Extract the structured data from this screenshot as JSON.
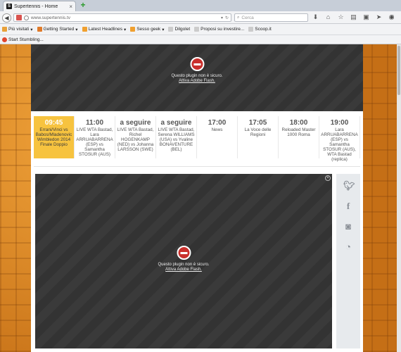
{
  "browser": {
    "tab_title": "Supertennis - Home",
    "tab_favicon": "S",
    "url": "www.supertennis.tv",
    "search_placeholder": "Cerca"
  },
  "bookmarks": [
    {
      "label": "Più visitati",
      "color": "#e8a13a"
    },
    {
      "label": "Getting Started",
      "color": "#e07b2a"
    },
    {
      "label": "Latest Headlines",
      "color": "#f0a030"
    },
    {
      "label": "Sesso geek",
      "color": "#f0a030"
    },
    {
      "label": "Dilgolet",
      "color": "#cccccc"
    },
    {
      "label": "Proposi su investire...",
      "color": "#cccccc"
    },
    {
      "label": "Scoop.it",
      "color": "#cccccc"
    }
  ],
  "bookmarks2": {
    "label": "Start Stumbling..."
  },
  "flash_top": {
    "line1": "Questo plugin non è sicuro.",
    "line2": "Attiva Adobe Flash."
  },
  "schedule": [
    {
      "time": "09:45",
      "desc": "Errani/Vinci vs Babos/Mladenovic Wimbledon 2014 Finale Doppio",
      "active": true
    },
    {
      "time": "11:00",
      "desc": "LIVE WTA Bastad, Lara ARRUABARRENA (ESP) vs Samantha STOSUR (AUS)",
      "active": false
    },
    {
      "time": "a seguire",
      "desc": "LIVE WTA Bastad, Richel HOGENKAMP (NED) vs Johanna LARSSON (SWE)",
      "active": false
    },
    {
      "time": "a seguire",
      "desc": "LIVE WTA Bastad, Serena WILLIAMS (USA) vs Yvaline BONAVENTURE (BEL)",
      "active": false
    },
    {
      "time": "17:00",
      "desc": "News",
      "active": false
    },
    {
      "time": "17:05",
      "desc": "La Voce delle Regioni",
      "active": false
    },
    {
      "time": "18:00",
      "desc": "Reloaded Master 1000 Roma",
      "active": false
    },
    {
      "time": "19:00",
      "desc": "Lara ARRUABARRENA (ESP) vs Samantha STOSUR (AUS), WTA Bastad (replica)",
      "active": false
    }
  ],
  "flash_video": {
    "line1": "Questo plugin non è sicuro.",
    "line2": "Attiva Adobe Flash."
  },
  "social": [
    "twitter-icon",
    "facebook-icon",
    "instagram-icon",
    "rss-icon"
  ]
}
